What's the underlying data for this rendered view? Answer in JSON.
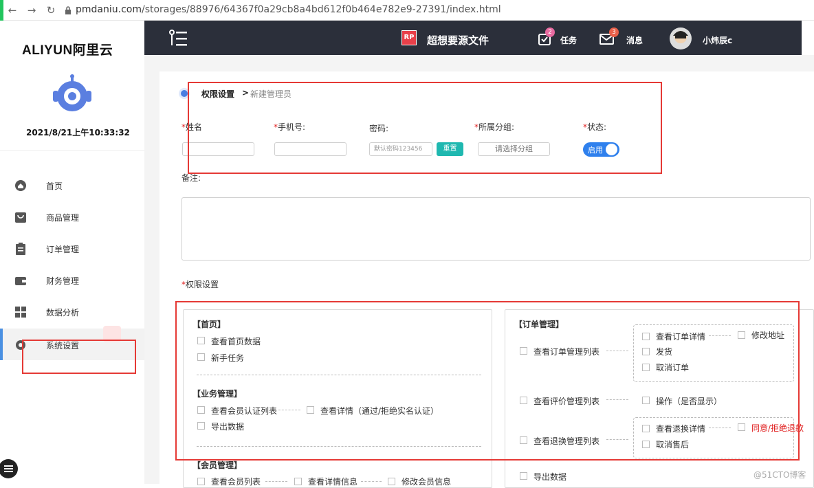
{
  "browser": {
    "url_host": "pmdaniu.com",
    "url_path": "/storages/88976/64367f0a29cb8a4bd612f0b464e782e9-27391/index.html"
  },
  "sidebar": {
    "brand": "ALIYUN阿里云",
    "datetime": "2021/8/21上午10:33:32",
    "items": [
      {
        "label": "首页",
        "icon": "home-icon"
      },
      {
        "label": "商品管理",
        "icon": "bag-icon"
      },
      {
        "label": "订单管理",
        "icon": "clipboard-icon"
      },
      {
        "label": "财务管理",
        "icon": "wallet-icon"
      },
      {
        "label": "数据分析",
        "icon": "grid-icon"
      },
      {
        "label": "系统设置",
        "icon": "gear-icon"
      }
    ]
  },
  "header": {
    "rp_badge": "RP",
    "project_title": "超想要源文件",
    "task_label": "任务",
    "task_count": "2",
    "message_label": "消息",
    "message_count": "3",
    "user_name": "小炜辰c"
  },
  "breadcrumb": {
    "parent": "权限设置",
    "separator": ">",
    "current": "新建管理员"
  },
  "form": {
    "name_label": "姓名",
    "phone_label": "手机号:",
    "password_label": "密码:",
    "password_placeholder": "默认密码123456",
    "reset_label": "重置",
    "group_label": "所属分组:",
    "group_placeholder": "请选择分组",
    "status_label": "状态:",
    "status_value": "启用",
    "remark_label": "备注:",
    "perm_label": "权限设置",
    "asterisk": "*"
  },
  "perm_left": {
    "home_title": "【首页】",
    "home_items": [
      "查看首页数据",
      "新手任务"
    ],
    "biz_title": "【业务管理】",
    "biz_items": [
      "查看会员认证列表",
      "查看详情（通过/拒绝实名认证）",
      "导出数据"
    ],
    "member_title": "【会员管理】",
    "member_items": [
      "查看会员列表",
      "查看详情信息",
      "修改会员信息"
    ]
  },
  "perm_right": {
    "order_title": "【订单管理】",
    "order_list": "查看订单管理列表",
    "order_detail": "查看订单详情",
    "order_address": "修改地址",
    "order_ship": "发货",
    "order_cancel": "取消订单",
    "review_list": "查看评价管理列表",
    "review_op": "操作（是否显示）",
    "return_list": "查看退换管理列表",
    "return_detail": "查看退换详情",
    "return_agree": "同意/拒绝退款",
    "return_cancel": "取消售后",
    "export": "导出数据"
  },
  "watermark": "@51CTO博客",
  "colors": {
    "accent": "#4a90e2",
    "danger": "#e53935",
    "header": "#2b2f3a",
    "teal": "#1fb8b0"
  }
}
